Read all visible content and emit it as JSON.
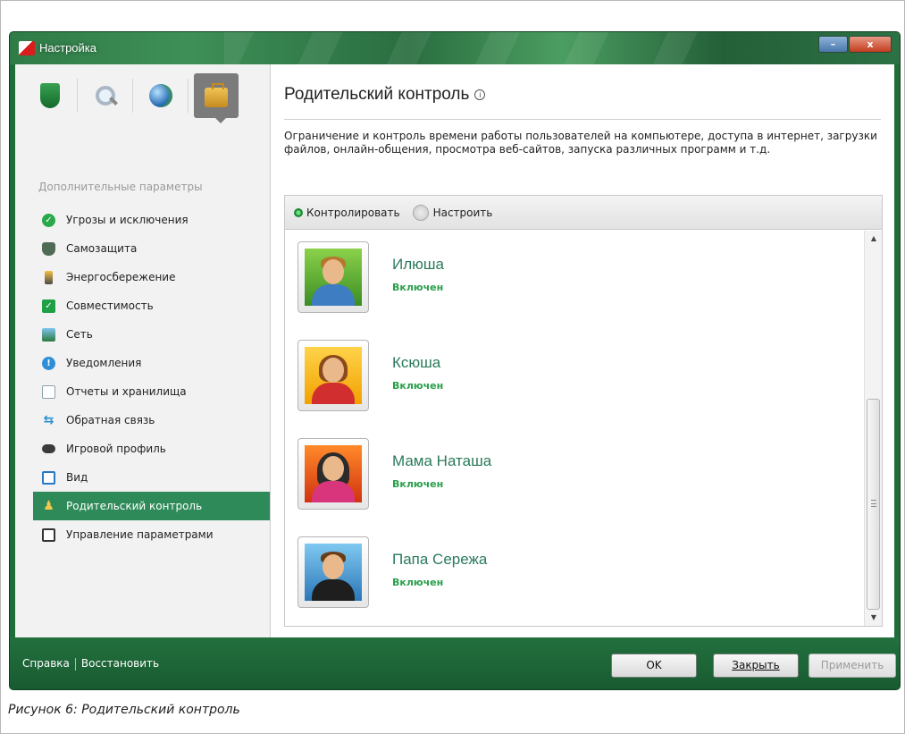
{
  "window": {
    "title": "Настройка",
    "minimize_label": "–",
    "close_label": "x"
  },
  "sidebar": {
    "top_icons": [
      "shield-icon",
      "search-icon",
      "globe-icon",
      "briefcase-icon"
    ],
    "section_label": "Дополнительные параметры",
    "items": [
      {
        "label": "Угрозы и исключения",
        "icon": "check-icon"
      },
      {
        "label": "Самозащита",
        "icon": "shield-icon"
      },
      {
        "label": "Энергосбережение",
        "icon": "battery-icon"
      },
      {
        "label": "Совместимость",
        "icon": "checkbox-icon"
      },
      {
        "label": "Сеть",
        "icon": "network-icon"
      },
      {
        "label": "Уведомления",
        "icon": "notification-icon"
      },
      {
        "label": "Отчеты и хранилища",
        "icon": "report-icon"
      },
      {
        "label": "Обратная связь",
        "icon": "feedback-icon"
      },
      {
        "label": "Игровой профиль",
        "icon": "gamepad-icon"
      },
      {
        "label": "Вид",
        "icon": "window-icon"
      },
      {
        "label": "Родительский контроль",
        "icon": "parental-control-icon",
        "selected": true
      },
      {
        "label": "Управление параметрами",
        "icon": "save-icon"
      }
    ]
  },
  "main": {
    "title": "Родительский контроль",
    "info_glyph": "i",
    "description": "Ограничение и контроль времени работы пользователей на компьютере, доступа в интернет, загрузки файлов, онлайн-общения, просмотра веб-сайтов, запуска различных программ и т.д.",
    "toolbar": {
      "control_label": "Контролировать",
      "configure_label": "Настроить"
    },
    "users": [
      {
        "name": "Илюша",
        "status": "Включен"
      },
      {
        "name": "Ксюша",
        "status": "Включен"
      },
      {
        "name": "Мама Наташа",
        "status": "Включен"
      },
      {
        "name": "Папа Сережа",
        "status": "Включен"
      }
    ],
    "scroll": {
      "up": "▲",
      "down": "▼"
    }
  },
  "footer": {
    "help": "Справка",
    "restore": "Восстановить",
    "ok": "OK",
    "close_label": "Закрыть",
    "apply": "Применить"
  },
  "caption": "Рисунок 6: Родительский контроль",
  "colors": {
    "frame_green": "#1f6e3a",
    "selected_item": "#2e8a59",
    "user_name": "#2a7a5a",
    "status_green": "#27a04a"
  }
}
